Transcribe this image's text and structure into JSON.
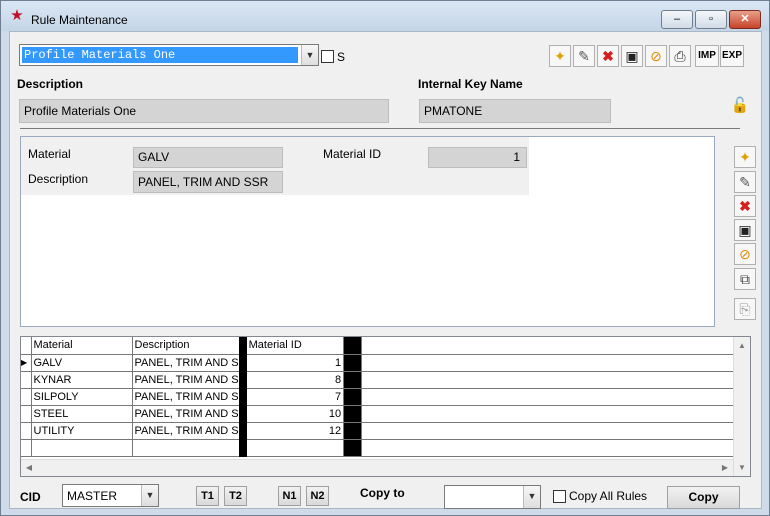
{
  "window": {
    "title": "Rule Maintenance",
    "min": "–",
    "max": "▫",
    "close": "✕"
  },
  "rule_select": {
    "value": "Profile Materials One"
  },
  "s_checkbox_label": "S",
  "toolbar": {
    "imp": "IMP",
    "exp": "EXP"
  },
  "labels": {
    "description": "Description",
    "internal_key": "Internal Key Name"
  },
  "fields": {
    "description": "Profile Materials One",
    "internal_key": "PMATONE"
  },
  "detail": {
    "material_label": "Material",
    "material_value": "GALV",
    "material_id_label": "Material ID",
    "material_id_value": "1",
    "description_label": "Description",
    "description_value": "PANEL, TRIM AND SSR"
  },
  "grid": {
    "columns": [
      "Material",
      "Description",
      "Material ID"
    ],
    "rows": [
      {
        "material": "GALV",
        "description": "PANEL, TRIM AND S",
        "id": "1"
      },
      {
        "material": "KYNAR",
        "description": "PANEL, TRIM AND S",
        "id": "8"
      },
      {
        "material": "SILPOLY",
        "description": "PANEL, TRIM AND S",
        "id": "7"
      },
      {
        "material": "STEEL",
        "description": "PANEL, TRIM AND S",
        "id": "10"
      },
      {
        "material": "UTILITY",
        "description": "PANEL, TRIM AND S",
        "id": "12"
      }
    ]
  },
  "bottom": {
    "cid_label": "CID",
    "cid_value": "MASTER",
    "t1": "T1",
    "t2": "T2",
    "n1": "N1",
    "n2": "N2",
    "copy_to_label": "Copy to",
    "copy_to_value": "",
    "copy_all_label": "Copy All Rules",
    "copy_button": "Copy"
  }
}
